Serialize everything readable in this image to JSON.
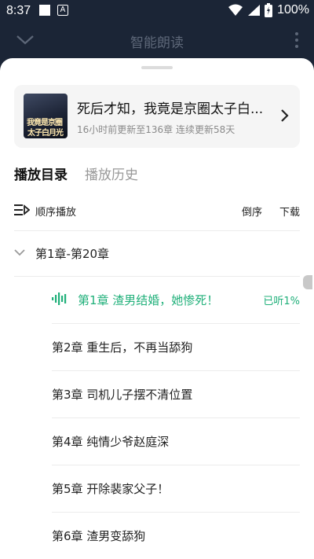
{
  "status_bar": {
    "time": "8:37",
    "app_badge": "A",
    "battery": "100%"
  },
  "top_bar": {
    "title": "智能朗读"
  },
  "book": {
    "title": "死后才知，我竟是京圈太子白...",
    "subtitle": "16小时前更新至136章 连续更新58天",
    "cover_line1": "我竟是京圈",
    "cover_line2": "太子白月光"
  },
  "tabs": [
    {
      "label": "播放目录",
      "active": true
    },
    {
      "label": "播放历史",
      "active": false
    }
  ],
  "toolbar": {
    "sequence_label": "顺序播放",
    "reverse_label": "倒序",
    "download_label": "下载"
  },
  "group": {
    "label": "第1章-第20章"
  },
  "chapters": [
    {
      "title": "第1章 渣男结婚，她惨死！",
      "progress": "已听1%",
      "playing": true
    },
    {
      "title": "第2章 重生后，不再当舔狗"
    },
    {
      "title": "第3章 司机儿子摆不清位置"
    },
    {
      "title": "第4章 纯情少爷赵庭深"
    },
    {
      "title": "第5章 开除裴家父子！"
    },
    {
      "title": "第6章 渣男变舔狗"
    }
  ],
  "colors": {
    "accent": "#20b07a",
    "header_bg": "#1b2536"
  }
}
